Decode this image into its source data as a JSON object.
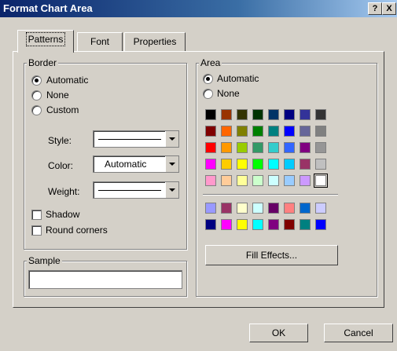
{
  "window": {
    "title": "Format Chart Area",
    "help_btn": "?",
    "close_btn": "X"
  },
  "tabs": [
    "Patterns",
    "Font",
    "Properties"
  ],
  "border": {
    "label": "Border",
    "automatic": "Automatic",
    "none": "None",
    "custom": "Custom",
    "style_label": "Style:",
    "color_label": "Color:",
    "color_value": "Automatic",
    "weight_label": "Weight:",
    "shadow": "Shadow",
    "round_corners": "Round corners"
  },
  "area": {
    "label": "Area",
    "automatic": "Automatic",
    "none": "None",
    "fill_effects": "Fill Effects...",
    "palette": [
      [
        "#000000",
        "#993300",
        "#333300",
        "#003300",
        "#003366",
        "#000080",
        "#333399",
        "#333333"
      ],
      [
        "#800000",
        "#ff6600",
        "#808000",
        "#008000",
        "#008080",
        "#0000ff",
        "#666699",
        "#808080"
      ],
      [
        "#ff0000",
        "#ff9900",
        "#99cc00",
        "#339966",
        "#33cccc",
        "#3366ff",
        "#800080",
        "#969696"
      ],
      [
        "#ff00ff",
        "#ffcc00",
        "#ffff00",
        "#00ff00",
        "#00ffff",
        "#00ccff",
        "#993366",
        "#c0c0c0"
      ],
      [
        "#ff99cc",
        "#ffcc99",
        "#ffff99",
        "#ccffcc",
        "#ccffff",
        "#99ccff",
        "#cc99ff",
        "#ffffff"
      ]
    ],
    "palette_extra": [
      [
        "#9999ff",
        "#993366",
        "#ffffcc",
        "#ccffff",
        "#660066",
        "#ff8080",
        "#0066cc",
        "#ccccff"
      ],
      [
        "#000080",
        "#ff00ff",
        "#ffff00",
        "#00ffff",
        "#800080",
        "#800000",
        "#008080",
        "#0000ff"
      ]
    ]
  },
  "sample": {
    "label": "Sample"
  },
  "buttons": {
    "ok": "OK",
    "cancel": "Cancel"
  }
}
